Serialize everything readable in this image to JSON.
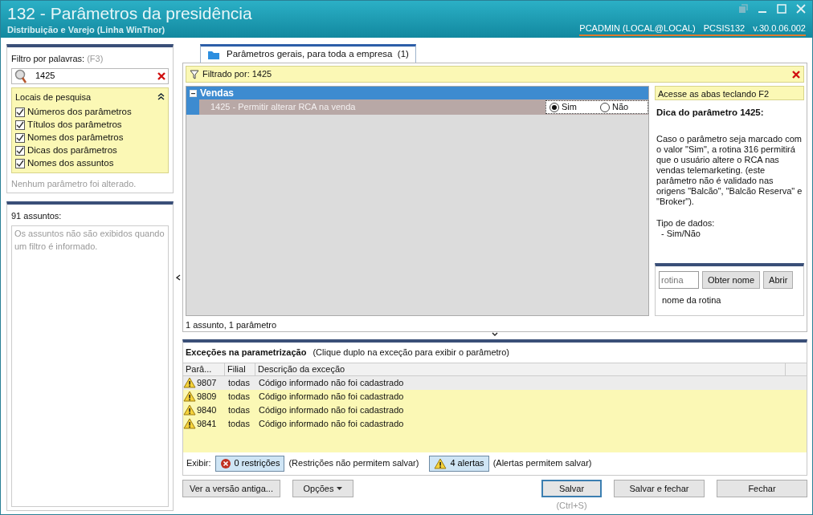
{
  "window": {
    "title": "132 - Parâmetros da presidência",
    "subtitle": "Distribuição e Varejo (Linha WinThor)",
    "user": "PCADMIN (LOCAL@LOCAL)",
    "program": "PCSIS132",
    "version": "v.30.0.06.002"
  },
  "filter": {
    "label": "Filtro por palavras:",
    "shortcut": "(F3)",
    "value": "1425"
  },
  "search_locations": {
    "title": "Locais de pesquisa",
    "expanded": true,
    "items": [
      {
        "label": "Números dos parâmetros",
        "checked": true
      },
      {
        "label": "Títulos dos parâmetros",
        "checked": true
      },
      {
        "label": "Nomes dos parâmetros",
        "checked": true
      },
      {
        "label": "Dicas dos parâmetros",
        "checked": true
      },
      {
        "label": "Nomes dos assuntos",
        "checked": true
      }
    ]
  },
  "changes_note": "Nenhum parâmetro foi alterado.",
  "subjects": {
    "label": "91 assuntos:",
    "note": "Os assuntos não são exibidos quando um filtro é informado."
  },
  "tabs": [
    {
      "label": "Parâmetros gerais, para toda a empresa",
      "count": "(1)",
      "selected": true
    }
  ],
  "filter_bar": {
    "text": "Filtrado por: 1425"
  },
  "groups": [
    {
      "name": "Vendas",
      "expanded": true,
      "params": [
        {
          "label": "1425 - Permitir alterar RCA na venda",
          "options": [
            {
              "label": "Sim",
              "selected": true
            },
            {
              "label": "Não",
              "selected": false
            }
          ]
        }
      ]
    }
  ],
  "summary": "1 assunto, 1 parâmetro",
  "hint": {
    "banner": "Acesse as abas teclando F2",
    "title": "Dica do parâmetro 1425:",
    "body": "Caso o parâmetro seja marcado com o valor \"Sim\", a rotina 316 permitirá que o usuário altere o RCA nas vendas telemarketing. (este parâmetro não é validado nas origens \"Balcão\", \"Balcão Reserva\" e \"Broker\").",
    "data_type_label": "Tipo de dados:",
    "data_type": "- Sim/Não"
  },
  "routine": {
    "placeholder": "rotina",
    "buttons": [
      "Obter nome",
      "Abrir"
    ],
    "name": "nome da rotina"
  },
  "exceptions": {
    "title": "Exceções na parametrização",
    "hint": "(Clique duplo na exceção para exibir o parâmetro)",
    "columns": [
      "Parâ...",
      "Filial",
      "Descrição da exceção"
    ],
    "rows": [
      {
        "kind": "alert",
        "param": "9807",
        "branch": "todas",
        "description": "Código informado não foi cadastrado",
        "selected": true
      },
      {
        "kind": "alert",
        "param": "9809",
        "branch": "todas",
        "description": "Código informado não foi cadastrado",
        "selected": false
      },
      {
        "kind": "alert",
        "param": "9840",
        "branch": "todas",
        "description": "Código informado não foi cadastrado",
        "selected": false
      },
      {
        "kind": "alert",
        "param": "9841",
        "branch": "todas",
        "description": "Código informado não foi cadastrado",
        "selected": false
      }
    ],
    "show_label": "Exibir:",
    "filters": [
      {
        "kind": "restriction",
        "label": "0 restrições",
        "note": "(Restrições não permitem salvar)"
      },
      {
        "kind": "alert",
        "label": "4 alertas",
        "note": "(Alertas permitem salvar)"
      }
    ]
  },
  "buttons": [
    {
      "label": "Ver a versão antiga...",
      "kind": "plain"
    },
    {
      "label": "Opções",
      "kind": "menu"
    },
    {
      "label": "Salvar",
      "kind": "default",
      "shortcut": "(Ctrl+S)"
    },
    {
      "label": "Salvar e fechar",
      "kind": "plain"
    },
    {
      "label": "Fechar",
      "kind": "plain"
    }
  ]
}
